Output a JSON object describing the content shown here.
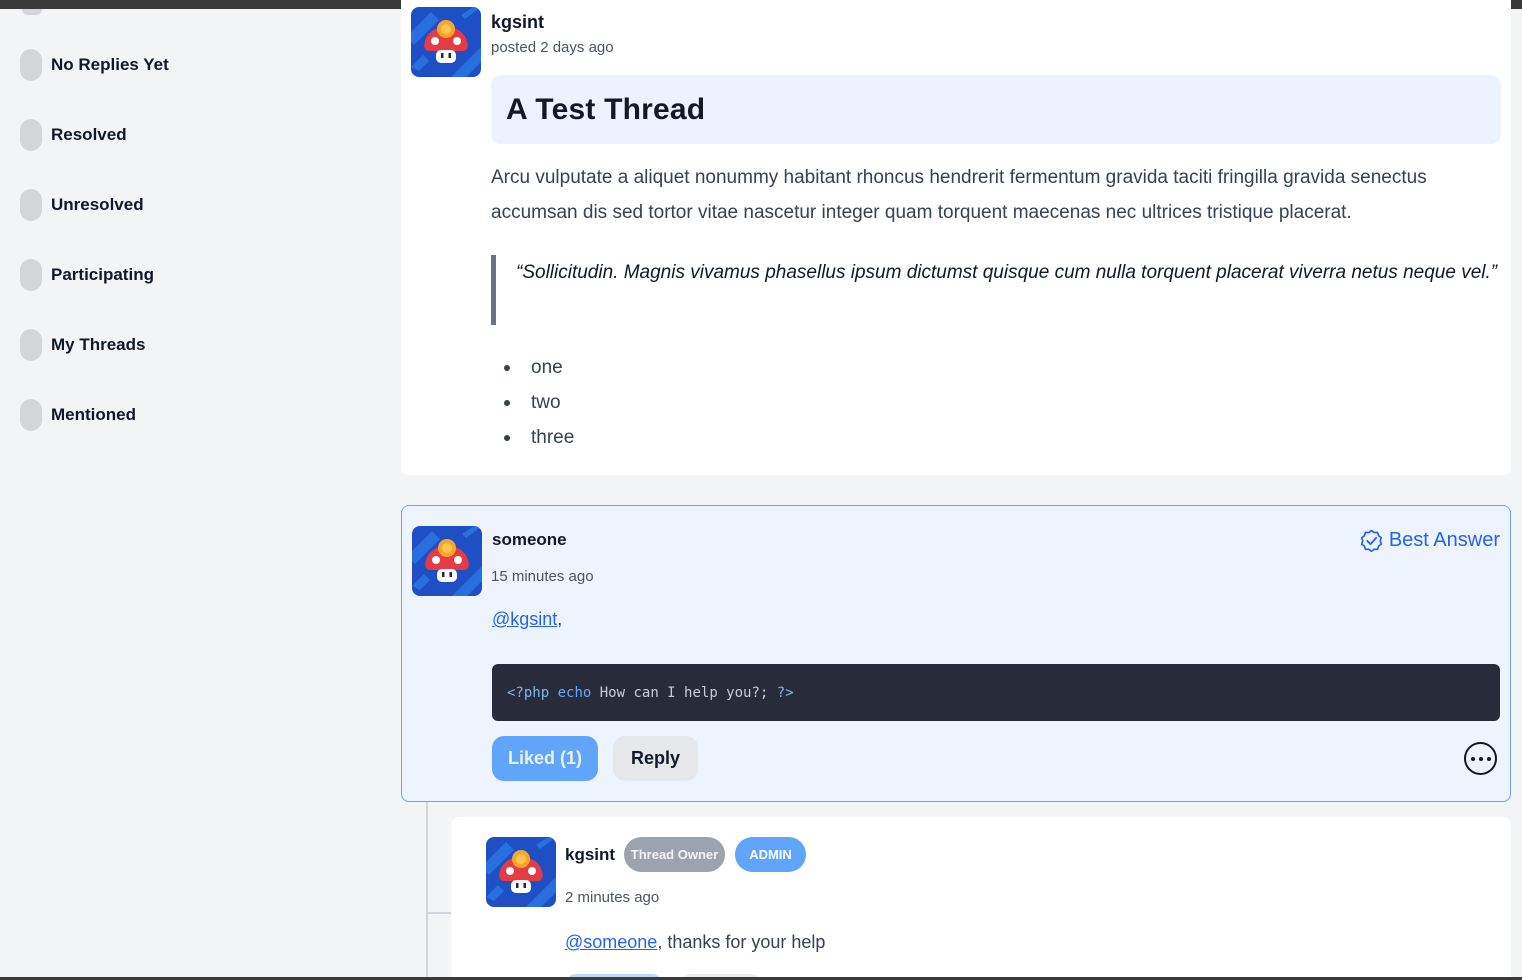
{
  "sidebar": {
    "filters": [
      {
        "label": "No Replies Yet"
      },
      {
        "label": "Resolved"
      },
      {
        "label": "Unresolved"
      },
      {
        "label": "Participating"
      },
      {
        "label": "My Threads"
      },
      {
        "label": "Mentioned"
      }
    ]
  },
  "thread": {
    "author": "kgsint",
    "posted": "posted 2 days ago",
    "title": "A Test Thread",
    "body": "Arcu vulputate a aliquet nonummy habitant rhoncus hendrerit fermentum gravida taciti fringilla gravida senectus accumsan dis sed tortor vitae nascetur integer quam torquent maecenas nec ultrices tristique placerat.",
    "quote": "“Sollicitudin. Magnis vivamus phasellus ipsum dictumst quisque cum nulla torquent placerat viverra netus neque vel.”",
    "list": [
      "one",
      "two",
      "three"
    ]
  },
  "reply": {
    "author": "someone",
    "time": "15 minutes ago",
    "best_answer_label": "Best Answer",
    "mention": "@kgsint",
    "mention_suffix": ",",
    "code": {
      "open_tag": "<?php",
      "keyword": "echo",
      "text": "How can I help you?;",
      "close_tag": "?>"
    },
    "liked_label": "Liked (1)",
    "reply_label": "Reply"
  },
  "nested_reply": {
    "author": "kgsint",
    "owner_badge": "Thread Owner",
    "admin_badge": "ADMIN",
    "time": "2 minutes ago",
    "mention": "@someone",
    "text": ", thanks for your help"
  },
  "colors": {
    "accent": "#2563eb",
    "liked_button": "#60a5fa",
    "reply_highlight_bg": "#edf4fd",
    "code_bg": "#282c3a"
  },
  "icons": {
    "avatar": "mushroom-avatar-icon",
    "best_answer": "check-badge-icon",
    "more": "ellipsis-circle-icon"
  }
}
